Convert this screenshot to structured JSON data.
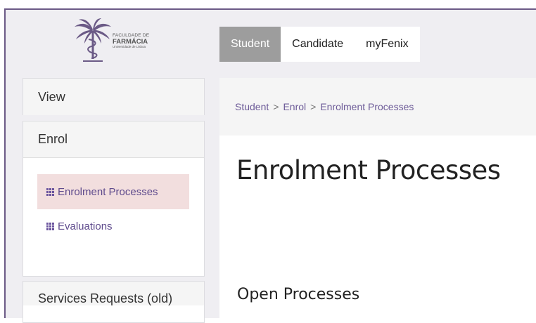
{
  "logo": {
    "line1": "FACULDADE DE",
    "line2": "FARMÁCIA",
    "line3": "Universidade de Lisboa"
  },
  "topnav": {
    "tabs": [
      {
        "label": "Student",
        "active": true
      },
      {
        "label": "Candidate",
        "active": false
      },
      {
        "label": "myFenix",
        "active": false
      }
    ]
  },
  "sidebar": {
    "view": {
      "label": "View"
    },
    "enrol": {
      "label": "Enrol",
      "items": [
        {
          "label": "Enrolment Processes",
          "icon": "grid-icon",
          "active": true
        },
        {
          "label": "Evaluations",
          "icon": "grid-icon",
          "active": false
        }
      ]
    },
    "services": {
      "label": "Services Requests (old)"
    }
  },
  "breadcrumb": {
    "items": [
      "Student",
      "Enrol",
      "Enrolment Processes"
    ],
    "separator": ">"
  },
  "main": {
    "title": "Enrolment Processes",
    "section_title": "Open Processes"
  },
  "colors": {
    "accent": "#6b5a86",
    "link": "#6d5b98",
    "active_tab": "#9d9d9d",
    "active_item_bg": "#f2dede"
  }
}
